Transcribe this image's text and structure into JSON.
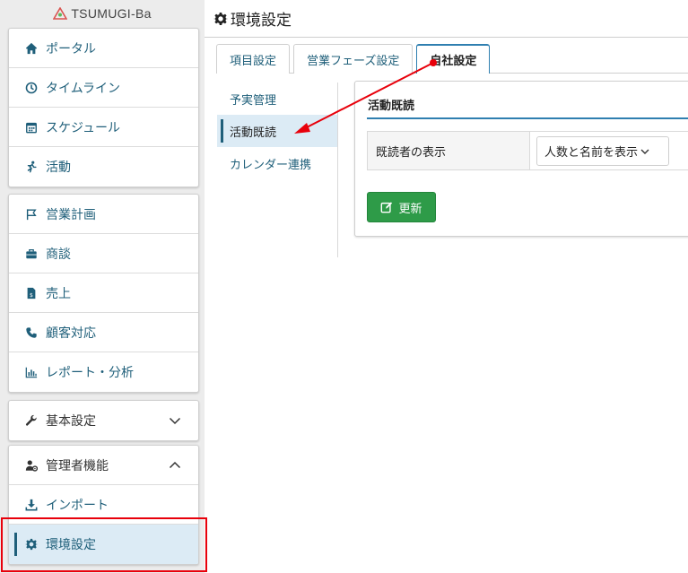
{
  "logo": {
    "text": "TSUMUGI-Ba"
  },
  "sidebar": {
    "group1": [
      {
        "label": "ポータル",
        "icon": "home-icon"
      },
      {
        "label": "タイムライン",
        "icon": "clock-icon"
      },
      {
        "label": "スケジュール",
        "icon": "calendar-icon"
      },
      {
        "label": "活動",
        "icon": "running-icon"
      }
    ],
    "group2": [
      {
        "label": "営業計画",
        "icon": "flag-icon"
      },
      {
        "label": "商談",
        "icon": "briefcase-icon"
      },
      {
        "label": "売上",
        "icon": "invoice-icon"
      },
      {
        "label": "顧客対応",
        "icon": "phone-icon"
      },
      {
        "label": "レポート・分析",
        "icon": "bar-chart-icon"
      }
    ],
    "basic_settings": {
      "label": "基本設定",
      "icon": "wrench-icon",
      "state": "collapsed"
    },
    "admin": {
      "label": "管理者機能",
      "icon": "user-cog-icon",
      "state": "expanded",
      "items": [
        {
          "label": "インポート",
          "icon": "download-icon"
        },
        {
          "label": "環境設定",
          "icon": "gear-icon",
          "active": true
        }
      ]
    }
  },
  "page": {
    "title": "環境設定",
    "title_icon": "gear-icon"
  },
  "tabs": [
    {
      "label": "項目設定"
    },
    {
      "label": "営業フェーズ設定"
    },
    {
      "label": "自社設定",
      "active": true
    }
  ],
  "subnav": [
    {
      "label": "予実管理"
    },
    {
      "label": "活動既読",
      "active": true
    },
    {
      "label": "カレンダー連携"
    }
  ],
  "card": {
    "title": "活動既読",
    "field_label": "既読者の表示",
    "select_value": "人数と名前を表示",
    "update_button": "更新"
  },
  "colors": {
    "link": "#1f5f7a",
    "accent_blue": "#2f7fb0",
    "active_bg": "#dcebf5",
    "update_green": "#2e9b48",
    "annotation_red": "#e8000b"
  }
}
